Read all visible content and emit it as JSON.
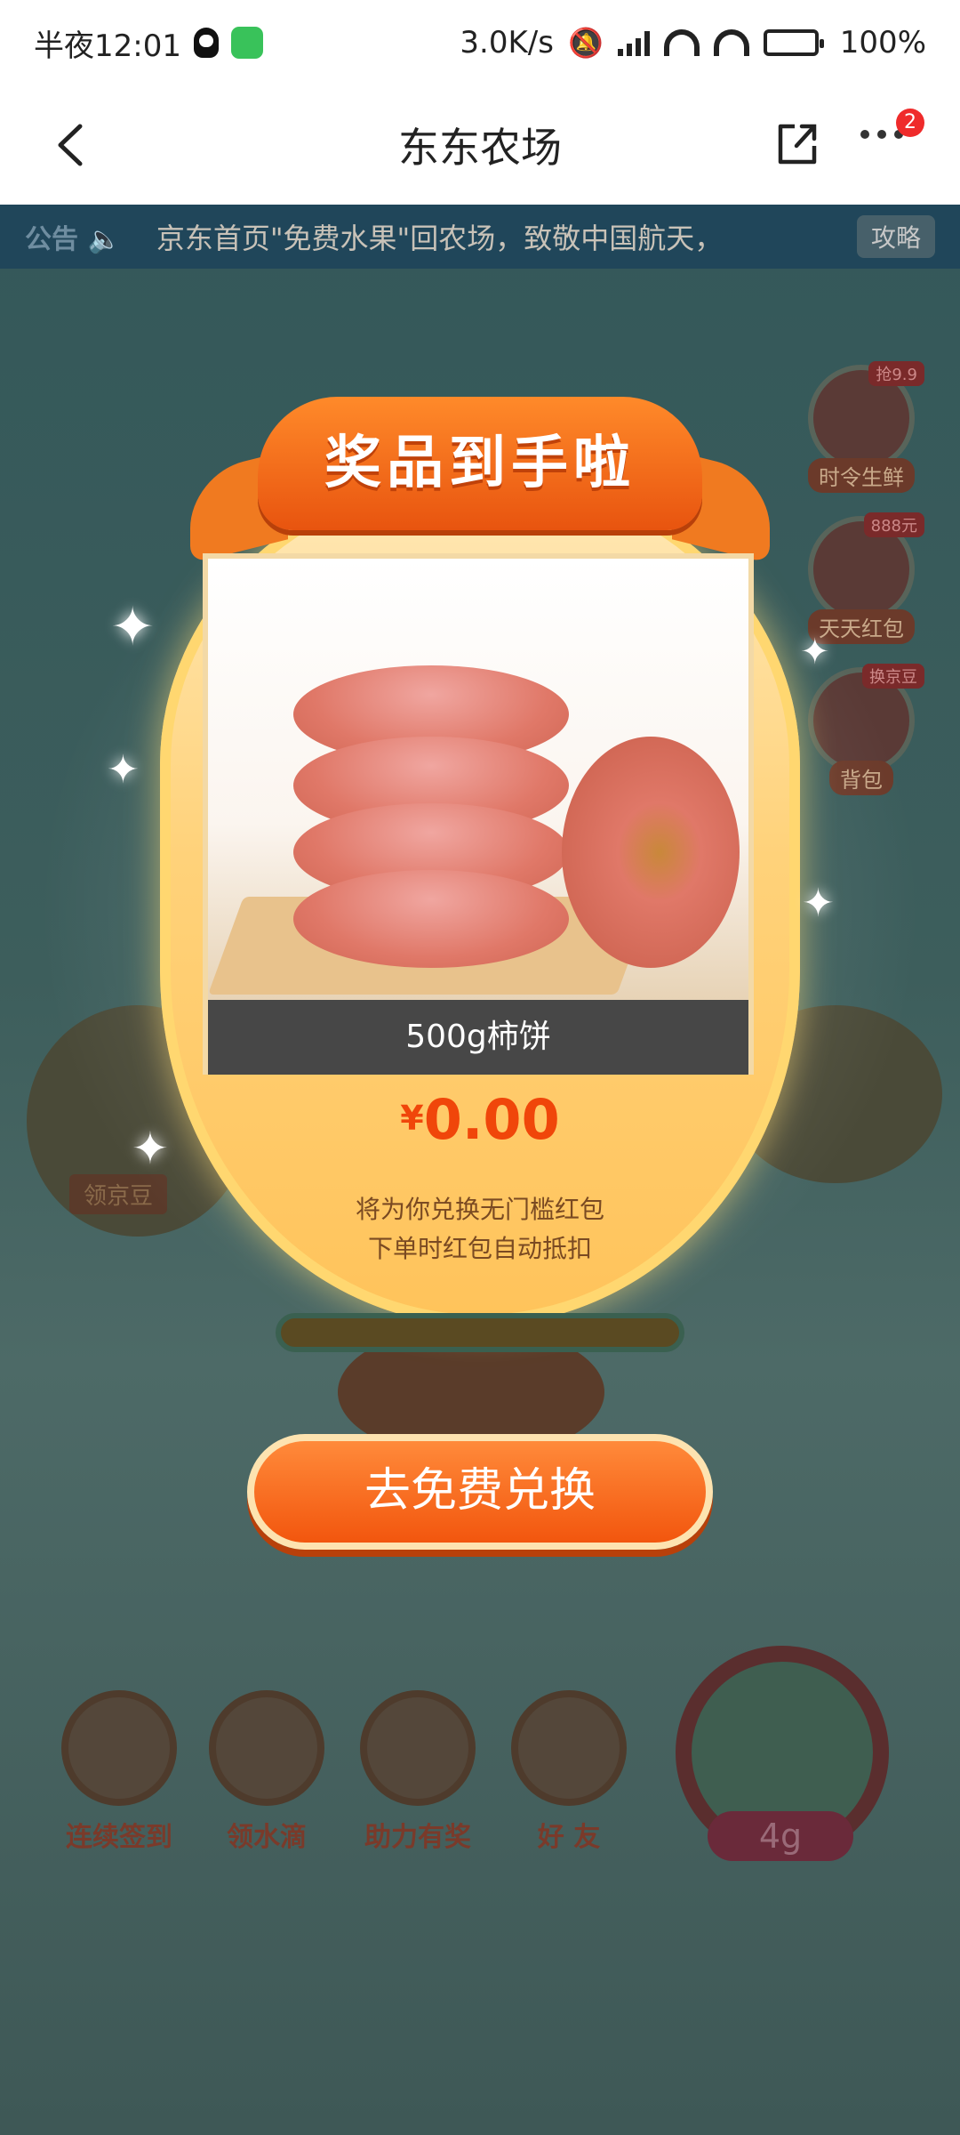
{
  "status_bar": {
    "time": "半夜12:01",
    "network_speed": "3.0K/s",
    "battery": "100%"
  },
  "header": {
    "title": "东东农场",
    "more_badge": "2"
  },
  "notice": {
    "label": "公告",
    "text": "京东首页\"免费水果\"回农场，致敬中国航天，",
    "guide_button": "攻略"
  },
  "side_items": [
    {
      "label": "时令生鲜",
      "tag": "抢9.9"
    },
    {
      "label": "天天红包",
      "tag": "888元"
    },
    {
      "label": "背包",
      "tag": "换京豆"
    }
  ],
  "bean_sign": "领京豆",
  "dock": [
    {
      "label": "连续签到"
    },
    {
      "label": "领水滴"
    },
    {
      "label": "助力有奖"
    },
    {
      "label": "好  友"
    }
  ],
  "water_amount": "4g",
  "prize_modal": {
    "ribbon_title": "奖品到手啦",
    "product_name": "500g柿饼",
    "currency": "¥",
    "price": "0.00",
    "desc_line1": "将为你兑换无门槛红包",
    "desc_line2": "下单时红包自动抵扣",
    "cta_label": "去免费兑换"
  },
  "icons": {
    "back": "chevron-left-icon",
    "share": "share-icon",
    "more": "more-icon",
    "speaker": "speaker-icon"
  },
  "colors": {
    "accent_orange": "#f2560e",
    "price_red": "#f0460a",
    "badge_red": "#ef2b2b",
    "notice_bg": "#20465a"
  }
}
